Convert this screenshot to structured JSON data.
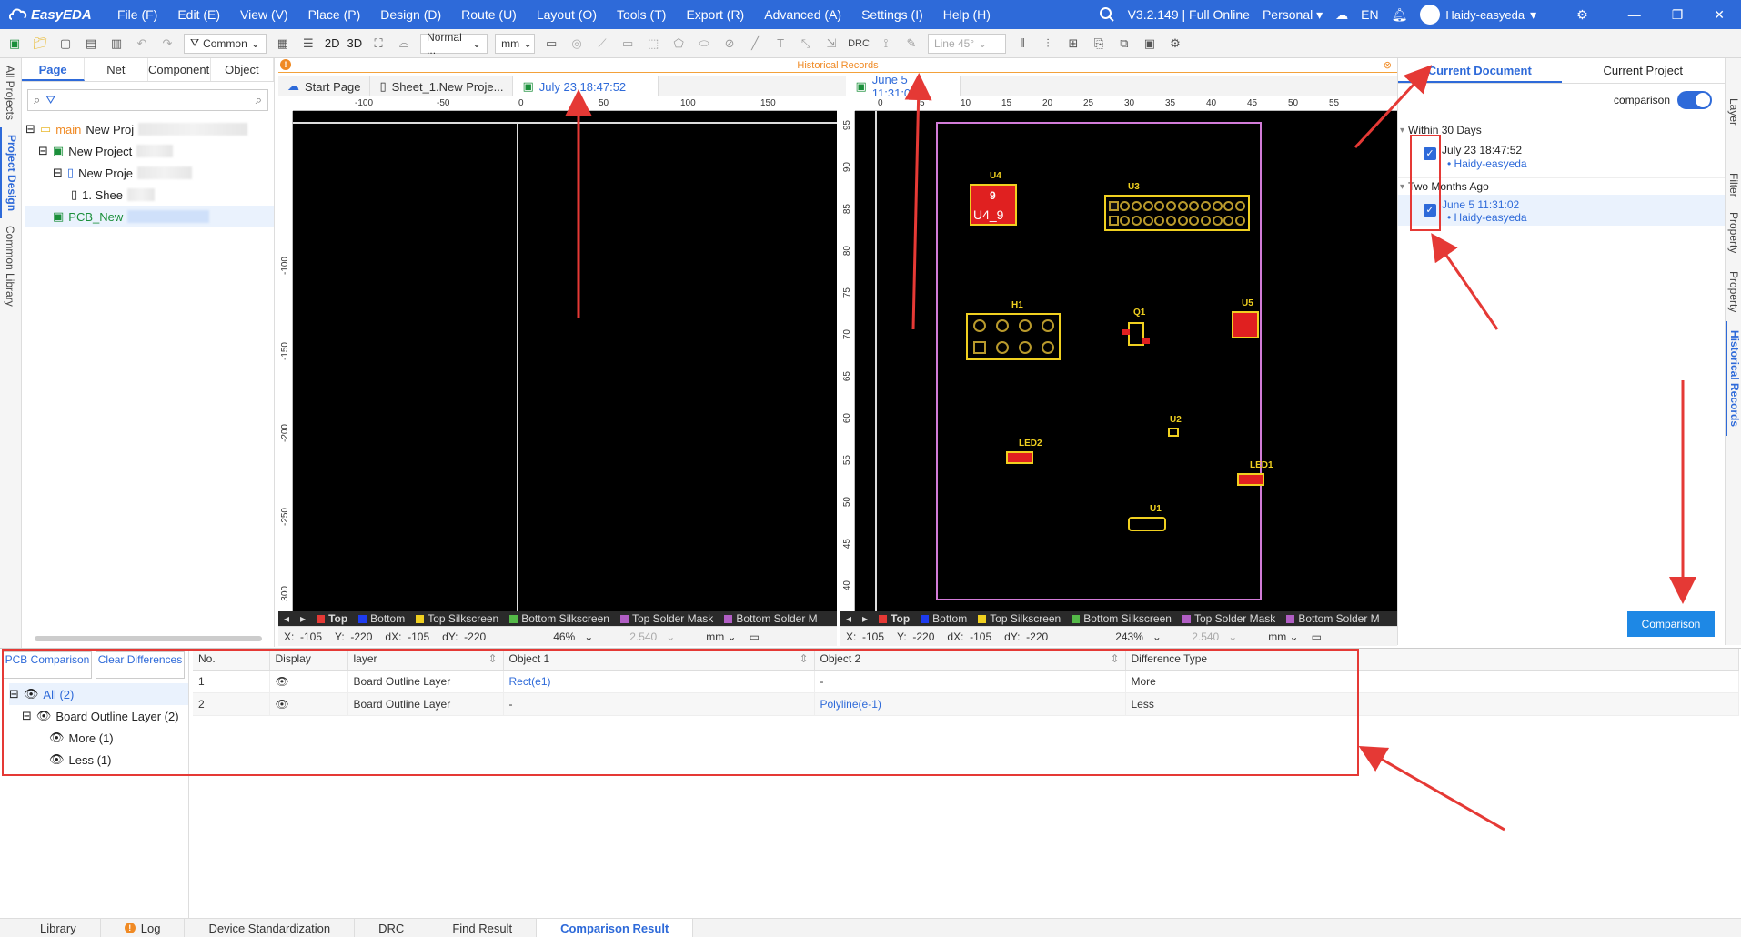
{
  "menubar": {
    "logo": "EasyEDA",
    "items": [
      "File (F)",
      "Edit (E)",
      "View (V)",
      "Place (P)",
      "Design (D)",
      "Route (U)",
      "Layout (O)",
      "Tools (T)",
      "Export (R)",
      "Advanced (A)",
      "Settings (I)",
      "Help (H)"
    ],
    "version": "V3.2.149 | Full Online",
    "plan": "Personal",
    "lang": "EN",
    "user": "Haidy-easyeda"
  },
  "toolbar": {
    "filter": "Common",
    "view2d": "2D",
    "view3d": "3D",
    "mode": "Normal ...",
    "unit": "mm",
    "drc": "DRC",
    "line": "Line 45°"
  },
  "left_vtabs": [
    "All Projects",
    "Project Design",
    "Common Library"
  ],
  "left_panel": {
    "tabs": [
      "Page",
      "Net",
      "Component",
      "Object"
    ],
    "tree": [
      {
        "badge": "main",
        "label": "New Proj"
      },
      {
        "label": "New Project"
      },
      {
        "label": "New Proje"
      },
      {
        "label": "1. Shee"
      },
      {
        "label": "PCB_New"
      }
    ]
  },
  "history_bar": "Historical Records",
  "doc_tabs": [
    "Start Page",
    "Sheet_1.New Proje...",
    "July 23 18:47:52",
    "June 5 11:31:02"
  ],
  "canvas_left": {
    "ruler_h": [
      "-100",
      "-50",
      "0",
      "50",
      "100",
      "150"
    ],
    "ruler_v": [
      "-100",
      "-150",
      "-200",
      "-250",
      "300"
    ],
    "layers": [
      "Top",
      "Bottom",
      "Top Silkscreen",
      "Bottom Silkscreen",
      "Top Solder Mask",
      "Bottom Solder M"
    ],
    "status": {
      "x": "-105",
      "y": "-220",
      "dx": "-105",
      "dy": "-220",
      "zoom": "46%",
      "grid": "2.540",
      "unit": "mm"
    }
  },
  "canvas_right": {
    "ruler_h": [
      "0",
      "5",
      "10",
      "15",
      "20",
      "25",
      "30",
      "35",
      "40",
      "45",
      "50",
      "55"
    ],
    "ruler_v": [
      "95",
      "90",
      "85",
      "80",
      "75",
      "70",
      "65",
      "60",
      "55",
      "50",
      "45",
      "40"
    ],
    "layers": [
      "Top",
      "Bottom",
      "Top Silkscreen",
      "Bottom Silkscreen",
      "Top Solder Mask",
      "Bottom Solder M"
    ],
    "status": {
      "x": "-105",
      "y": "-220",
      "dx": "-105",
      "dy": "-220",
      "zoom": "243%",
      "grid": "2.540",
      "unit": "mm"
    },
    "components": [
      "U4",
      "U4_9",
      "9",
      "U3",
      "H1",
      "Q1",
      "U5",
      "U2",
      "LED2",
      "LED1",
      "U1"
    ]
  },
  "layer_colors": {
    "Top": "#e53935",
    "Bottom": "#1e3cf0",
    "Top Silkscreen": "#f0d020",
    "Bottom Silkscreen": "#54b948",
    "Top Solder Mask": "#b15ec4",
    "Bottom Solder M": "#b15ec4"
  },
  "right_panel": {
    "tabs": [
      "Current Document",
      "Current Project"
    ],
    "comparison_label": "comparison",
    "groups": [
      {
        "title": "Within 30 Days",
        "items": [
          {
            "date": "July 23 18:47:52",
            "user": "Haidy-easyeda"
          }
        ]
      },
      {
        "title": "Two Months Ago",
        "items": [
          {
            "date": "June 5 11:31:02",
            "user": "Haidy-easyeda"
          }
        ]
      }
    ],
    "comparison_button": "Comparison"
  },
  "right_vtabs": [
    "Layer",
    "Filter",
    "Property",
    "Property",
    "Historical Records"
  ],
  "bottom": {
    "buttons": [
      "PCB Comparison",
      "Clear Differences"
    ],
    "tree": [
      {
        "label": "All (2)"
      },
      {
        "label": "Board Outline Layer (2)"
      },
      {
        "label": "More (1)"
      },
      {
        "label": "Less (1)"
      }
    ],
    "columns": [
      "No.",
      "Display",
      "layer",
      "Object 1",
      "Object 2",
      "Difference Type"
    ],
    "rows": [
      {
        "no": "1",
        "layer": "Board Outline Layer",
        "obj1": "Rect(e1)",
        "obj2": "-",
        "type": "More"
      },
      {
        "no": "2",
        "layer": "Board Outline Layer",
        "obj1": "-",
        "obj2": "Polyline(e-1)",
        "type": "Less"
      }
    ]
  },
  "bottom_tabs": [
    "Library",
    "Log",
    "Device Standardization",
    "DRC",
    "Find Result",
    "Comparison Result"
  ]
}
